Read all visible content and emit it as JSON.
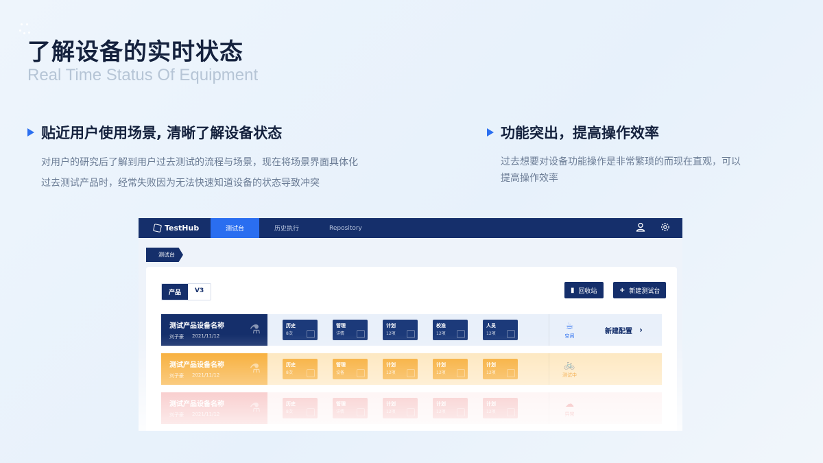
{
  "header": {
    "title": "了解设备的实时状态",
    "subtitle": "Real Time Status Of Equipment"
  },
  "features": [
    {
      "title": "贴近用户使用场景, 清晰了解设备状态",
      "lines": [
        "对用户的研究后了解到用户过去测试的流程与场景，现在将场景界面具体化",
        "过去测试产品时，经常失败因为无法快速知道设备的状态导致冲突"
      ]
    },
    {
      "title": "功能突出，提高操作效率",
      "lines": [
        "过去想要对设备功能操作是非常繁琐的而现在直观，可以",
        "提高操作效率"
      ]
    }
  ],
  "app": {
    "logo": "TestHub",
    "tabs": [
      "测试台",
      "历史执行",
      "Repository"
    ],
    "breadcrumb": "测试台",
    "segment": [
      "产品",
      "V3"
    ],
    "buttons": {
      "recycle": "回收站",
      "new_bench": "新建测试台"
    },
    "rows": [
      {
        "name": "测试产品设备名称",
        "owner": "刘子豪",
        "date": "2021/11/12",
        "chips": [
          {
            "title": "历史",
            "sub": "8次"
          },
          {
            "title": "管理",
            "sub": "详情"
          },
          {
            "title": "计划",
            "sub": "12项"
          },
          {
            "title": "校准",
            "sub": "12项"
          },
          {
            "title": "人员",
            "sub": "12项"
          }
        ],
        "status": "空闲",
        "status_icon": "cup-icon",
        "action": "新建配置"
      },
      {
        "name": "测试产品设备名称",
        "owner": "刘子豪",
        "date": "2021/11/12",
        "chips": [
          {
            "title": "历史",
            "sub": "8次"
          },
          {
            "title": "管理",
            "sub": "设备"
          },
          {
            "title": "计划",
            "sub": "12项"
          },
          {
            "title": "计划",
            "sub": "12项"
          },
          {
            "title": "计划",
            "sub": "12项"
          }
        ],
        "status": "测试中",
        "status_icon": "bike-icon"
      },
      {
        "name": "测试产品设备名称",
        "owner": "刘子豪",
        "date": "2021/11/12",
        "chips": [
          {
            "title": "历史",
            "sub": "8次"
          },
          {
            "title": "管理",
            "sub": "详情"
          },
          {
            "title": "计划",
            "sub": "12项"
          },
          {
            "title": "计划",
            "sub": "12项"
          },
          {
            "title": "计划",
            "sub": "12项"
          }
        ],
        "status": "异常",
        "status_icon": "cloud-error-icon"
      }
    ]
  },
  "colors": {
    "navy": "#152f6b",
    "accent": "#2a6ef0",
    "orange": "#f6a21b",
    "red": "#ee7d7d"
  }
}
